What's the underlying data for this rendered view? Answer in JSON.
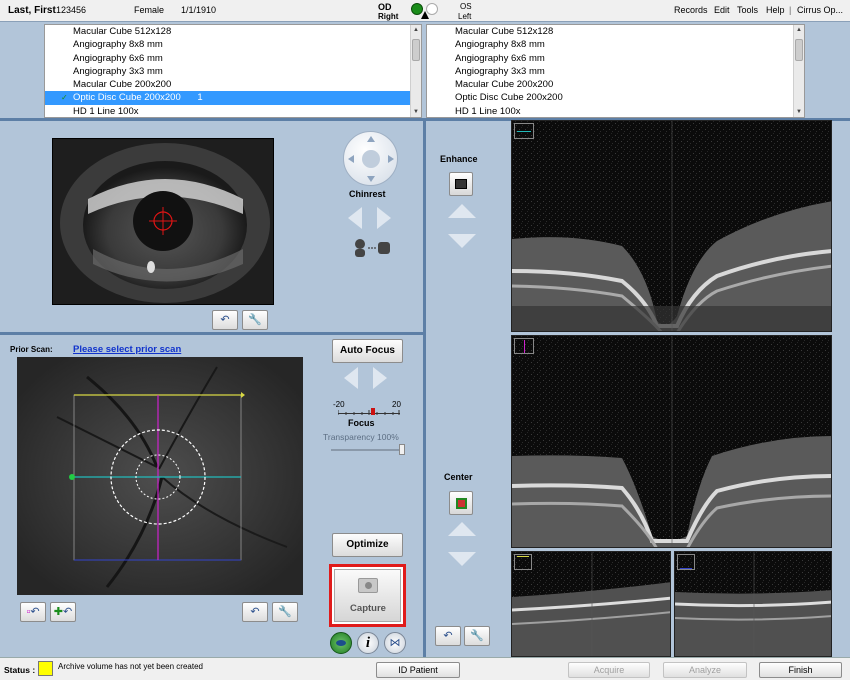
{
  "patient": {
    "name": "Last, First",
    "id": "123456",
    "sex": "Female",
    "dob": "1/1/1910"
  },
  "eyes": {
    "od_label": "OD",
    "od_sub": "Right",
    "os_label": "OS",
    "os_sub": "Left",
    "selected": "OD"
  },
  "menu": [
    "Records",
    "Edit",
    "Tools",
    "Help",
    "Cirrus Op..."
  ],
  "scan_list_right": [
    {
      "label": "Macular Cube 512x128"
    },
    {
      "label": "Angiography 8x8 mm"
    },
    {
      "label": "Angiography 6x6 mm"
    },
    {
      "label": "Angiography 3x3 mm"
    },
    {
      "label": "Macular Cube 200x200"
    },
    {
      "label": "Optic Disc Cube 200x200",
      "count": "1",
      "selected": true
    },
    {
      "label": "HD 1 Line 100x"
    }
  ],
  "scan_list_left": [
    {
      "label": "Macular Cube 512x128"
    },
    {
      "label": "Angiography 8x8 mm"
    },
    {
      "label": "Angiography 6x6 mm"
    },
    {
      "label": "Angiography 3x3 mm"
    },
    {
      "label": "Macular Cube 200x200"
    },
    {
      "label": "Optic Disc Cube 200x200"
    },
    {
      "label": "HD 1 Line 100x"
    }
  ],
  "iris": {
    "chinrest_label": "Chinrest"
  },
  "prior_scan": {
    "label": "Prior Scan:",
    "link": "Please select prior scan"
  },
  "controls": {
    "auto_focus": "Auto Focus",
    "focus_min": "-20",
    "focus_max": "20",
    "focus_label": "Focus",
    "focus_value_fraction": 0.57,
    "transparency_label": "Transparency 100%",
    "transparency_value_fraction": 1.0,
    "optimize": "Optimize",
    "capture": "Capture"
  },
  "oct_controls": {
    "enhance": "Enhance",
    "center": "Center"
  },
  "status": {
    "label": "Status :",
    "message": "Archive volume has not yet been created",
    "color": "#ffff00"
  },
  "footer": {
    "id_patient": "ID Patient",
    "acquire": "Acquire",
    "analyze": "Analyze",
    "finish": "Finish"
  }
}
